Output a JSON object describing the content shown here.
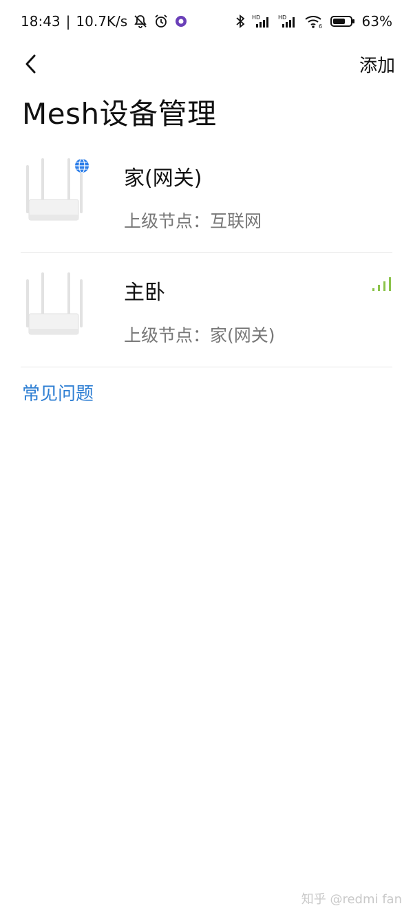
{
  "status_bar": {
    "time": "18:43",
    "speed": "10.7K/s",
    "battery": "63%",
    "icons": [
      "mute-bell-icon",
      "alarm-icon",
      "app-icon",
      "bluetooth-icon",
      "signal-hd-icon",
      "signal-hd-icon",
      "wifi-icon",
      "battery-icon"
    ]
  },
  "header": {
    "back_icon": "chevron-left-icon",
    "add_label": "添加"
  },
  "page": {
    "title": "Mesh设备管理"
  },
  "devices": [
    {
      "name": "家(网关)",
      "parent": "上级节点：互联网",
      "badge": "globe-icon",
      "badge_color": "#2b7de9"
    },
    {
      "name": "主卧",
      "parent": "上级节点：家(网关)",
      "signal_color": "#8bc34a"
    }
  ],
  "faq_label": "常见问题",
  "watermark": "知乎 @redmi fan",
  "colors": {
    "link": "#2f7fd3",
    "divider": "#e6e6e6"
  }
}
